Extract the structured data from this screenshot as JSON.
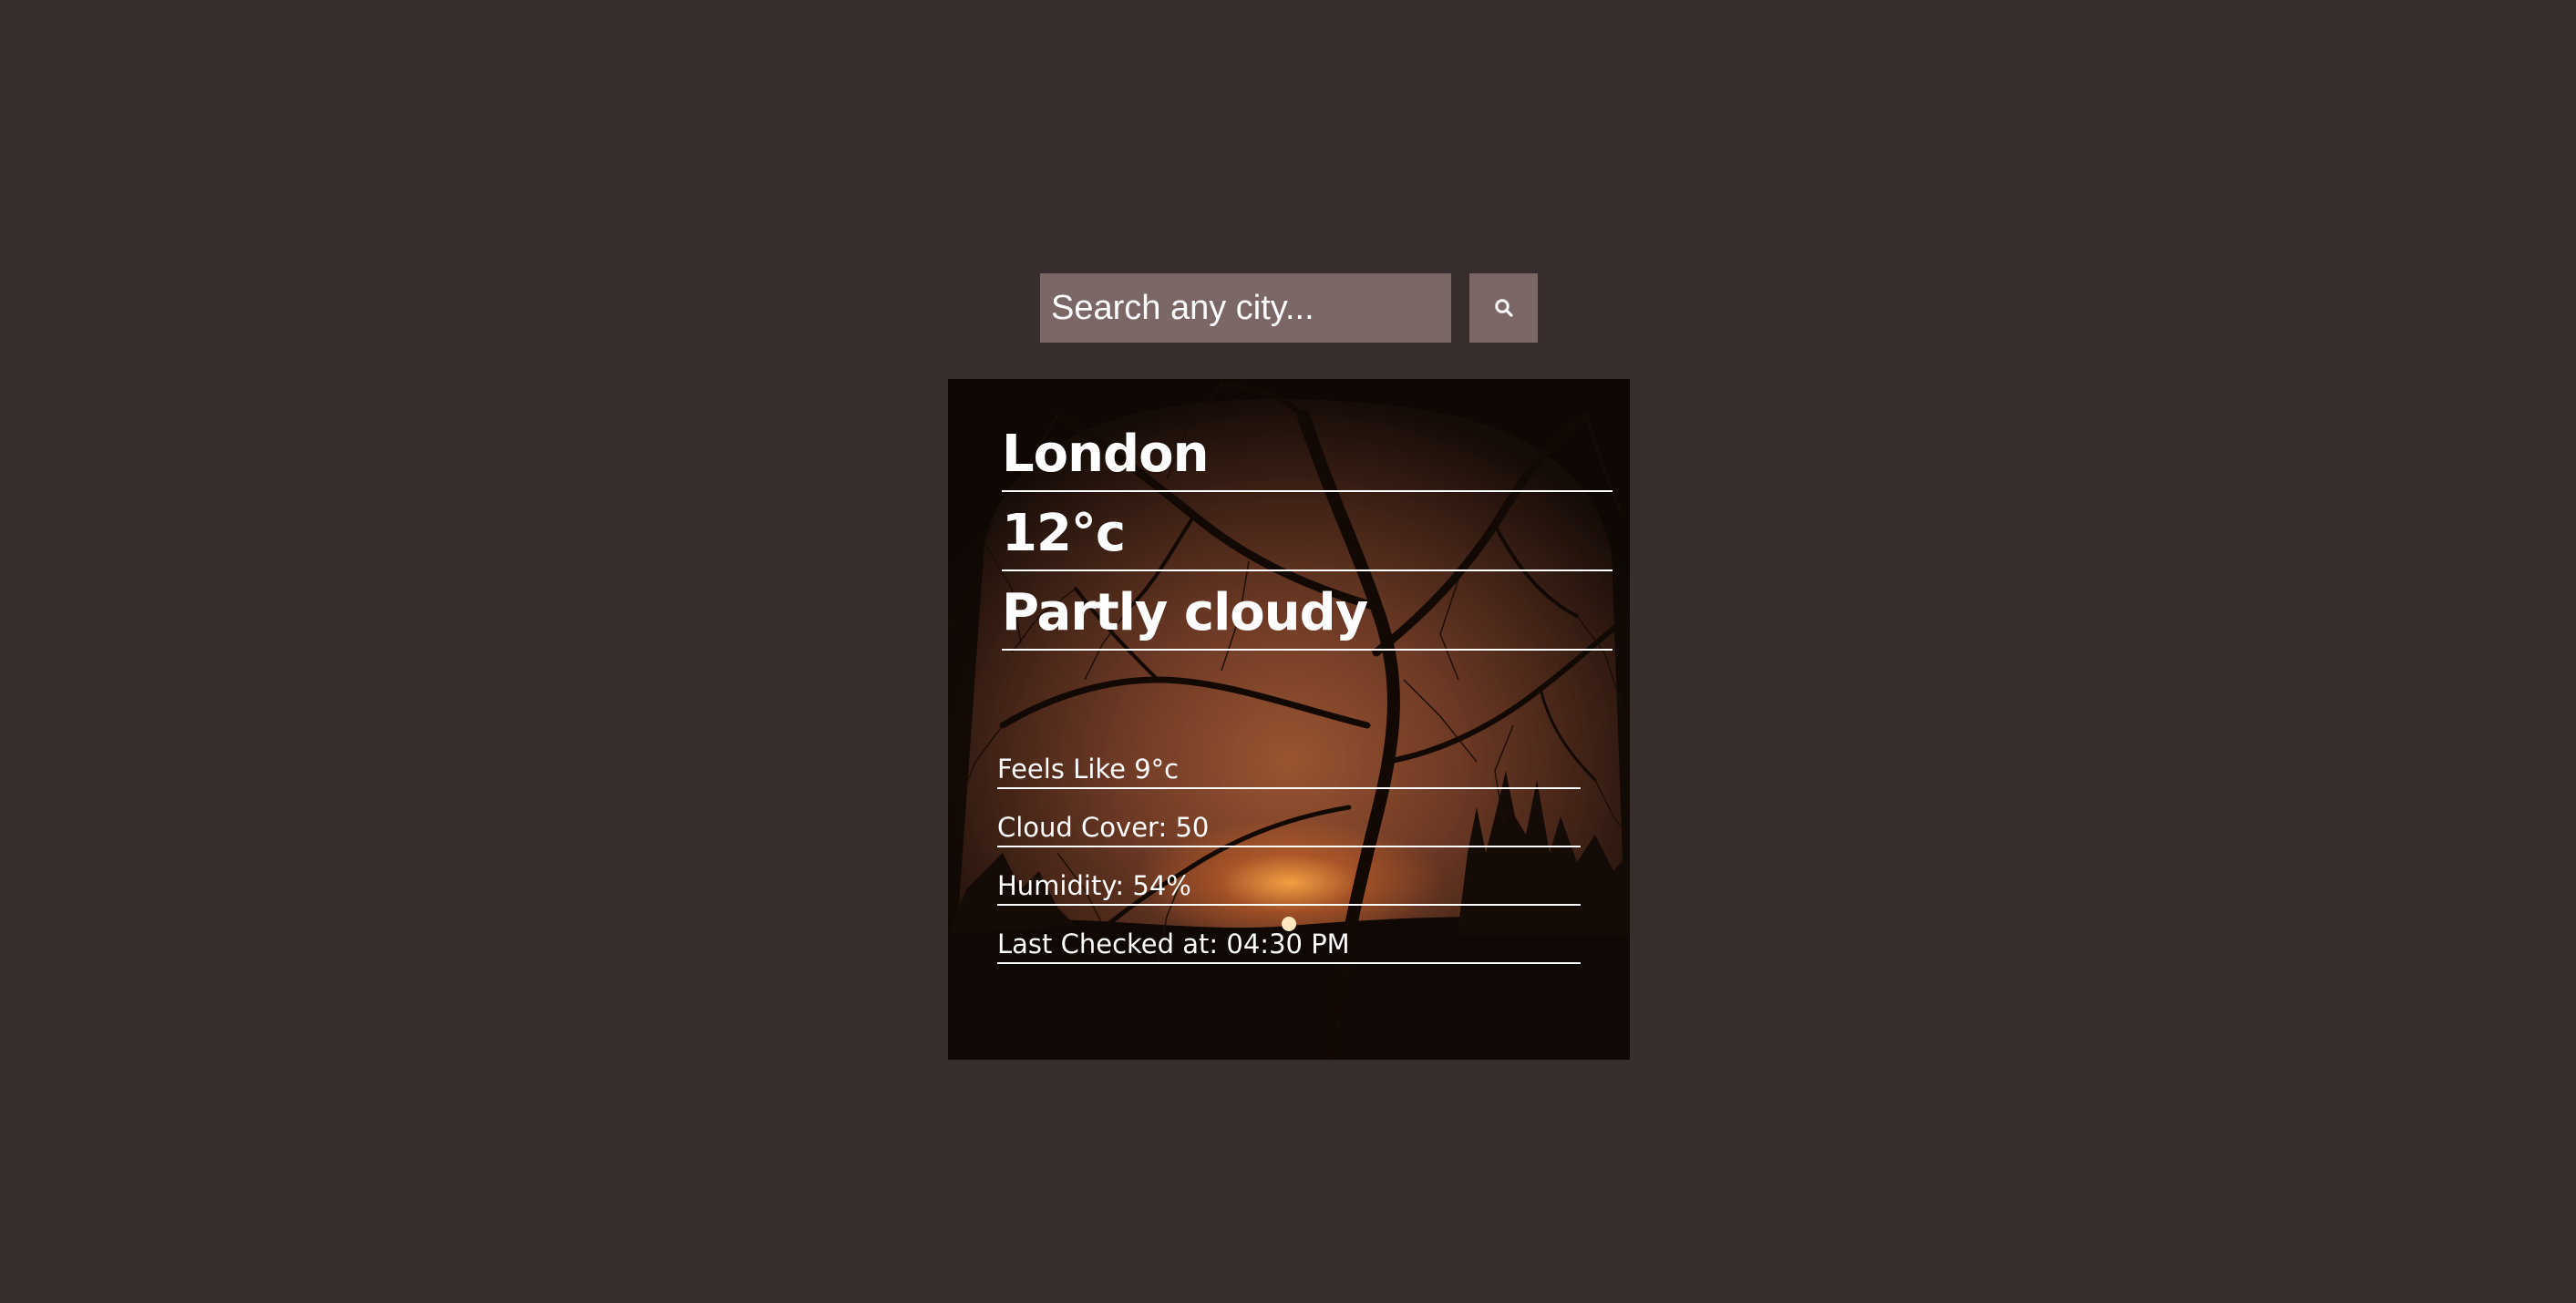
{
  "search": {
    "placeholder": "Search any city...",
    "button_icon": "search-icon"
  },
  "weather": {
    "city": "London",
    "temperature": "12°c",
    "condition": "Partly cloudy",
    "background_icon": "sunset-trees-photo"
  },
  "details": {
    "feels_like": "Feels Like 9°c",
    "cloud_cover": "Cloud Cover: 50",
    "humidity": "Humidity: 54%",
    "last_checked": "Last Checked at: 04:30 PM"
  },
  "colors": {
    "page_background": "#372d2d",
    "search_background": "#7c6767",
    "text": "#ffffff"
  }
}
